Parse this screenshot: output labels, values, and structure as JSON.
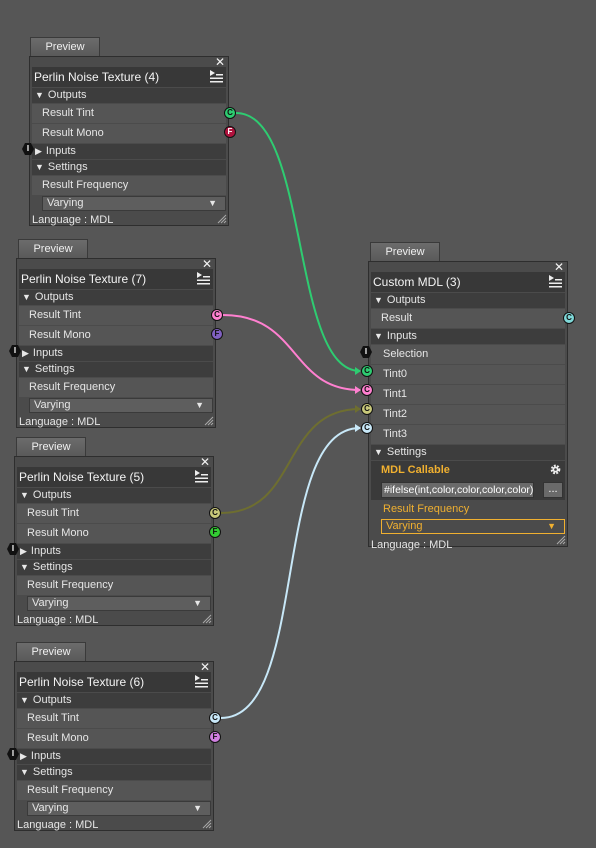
{
  "colors": {
    "tint_c": "#2ecc71",
    "mono_f": "#b0123d",
    "pink": "#ff80d0",
    "olive": "#777733",
    "lightblue": "#c8e8f8",
    "purple": "#8060c0",
    "green": "#33cc33",
    "orange": "#f0b030"
  },
  "nodes": [
    {
      "preview": "Preview",
      "title": "Perlin Noise Texture (4)",
      "outputs_label": "Outputs",
      "outputs": [
        "Result Tint",
        "Result Mono"
      ],
      "inputs_label": "Inputs",
      "settings_label": "Settings",
      "frequency_label": "Result Frequency",
      "frequency_value": "Varying",
      "language": "Language : MDL"
    },
    {
      "preview": "Preview",
      "title": "Perlin Noise Texture (7)",
      "outputs_label": "Outputs",
      "outputs": [
        "Result Tint",
        "Result Mono"
      ],
      "inputs_label": "Inputs",
      "settings_label": "Settings",
      "frequency_label": "Result Frequency",
      "frequency_value": "Varying",
      "language": "Language : MDL"
    },
    {
      "preview": "Preview",
      "title": "Perlin Noise Texture (5)",
      "outputs_label": "Outputs",
      "outputs": [
        "Result Tint",
        "Result Mono"
      ],
      "inputs_label": "Inputs",
      "settings_label": "Settings",
      "frequency_label": "Result Frequency",
      "frequency_value": "Varying",
      "language": "Language : MDL"
    },
    {
      "preview": "Preview",
      "title": "Perlin Noise Texture (6)",
      "outputs_label": "Outputs",
      "outputs": [
        "Result Tint",
        "Result Mono"
      ],
      "inputs_label": "Inputs",
      "settings_label": "Settings",
      "frequency_label": "Result Frequency",
      "frequency_value": "Varying",
      "language": "Language : MDL"
    }
  ],
  "custom": {
    "preview": "Preview",
    "title": "Custom MDL (3)",
    "outputs_label": "Outputs",
    "result_label": "Result",
    "inputs_label": "Inputs",
    "inputs": [
      "Selection",
      "Tint0",
      "Tint1",
      "Tint2",
      "Tint3"
    ],
    "settings_label": "Settings",
    "callable_label": "MDL Callable",
    "callable_value": "#ifelse(int,color,color,color,color)",
    "callable_button": "...",
    "frequency_label": "Result Frequency",
    "frequency_value": "Varying",
    "language": "Language : MDL"
  },
  "port_letters": {
    "color": "C",
    "float": "F",
    "int": "I"
  }
}
